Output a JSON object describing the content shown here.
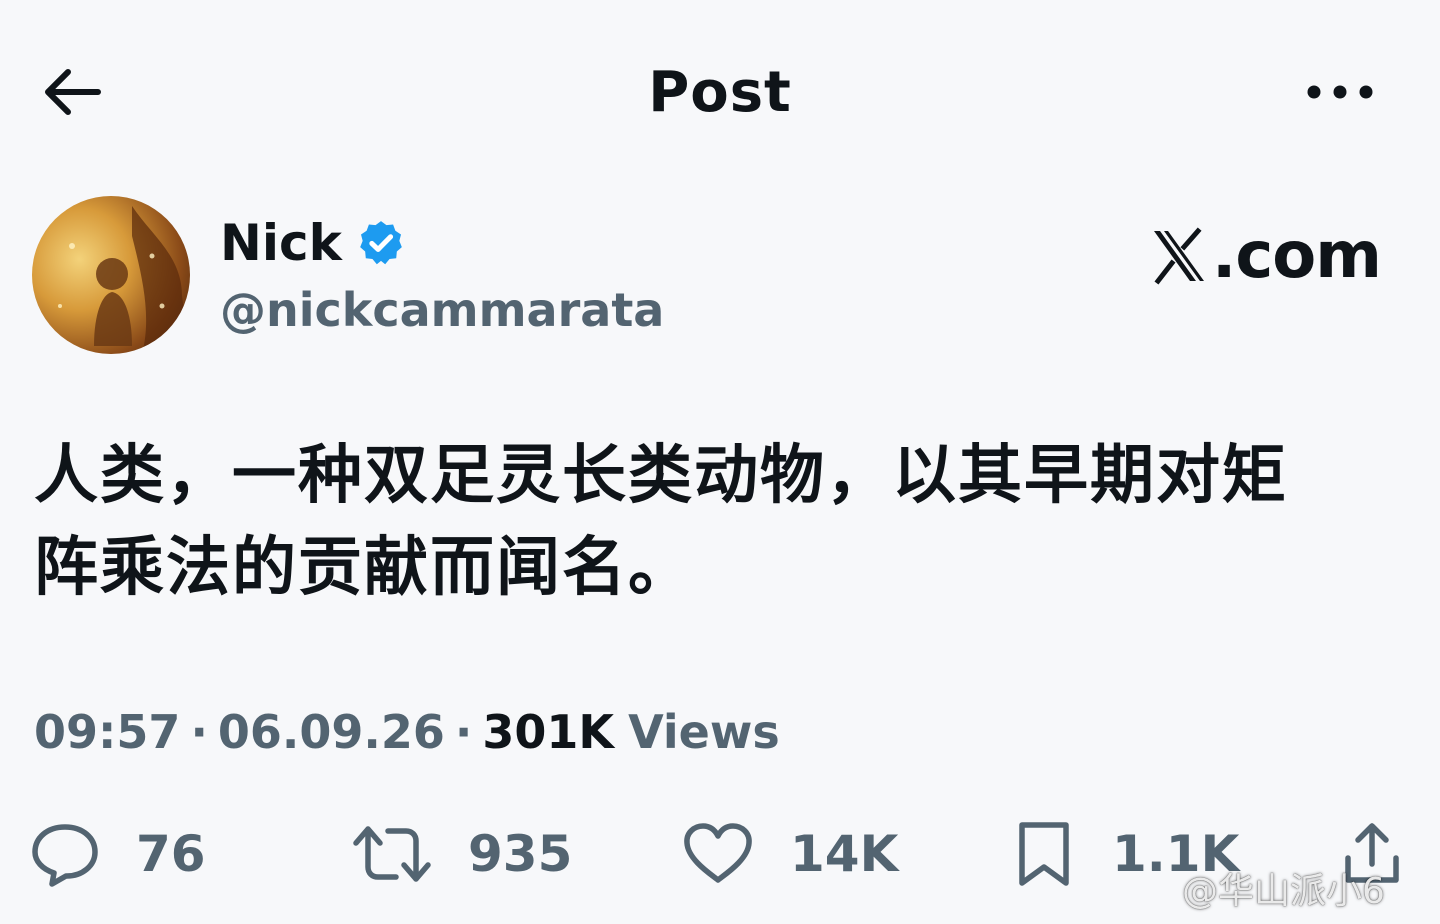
{
  "header": {
    "title": "Post"
  },
  "author": {
    "name": "Nick",
    "handle": "@nickcammarata",
    "verified": true
  },
  "brand": {
    "text": ".com"
  },
  "post": {
    "text": "人类，一种双足灵长类动物，以其早期对矩阵乘法的贡献而闻名。",
    "time": "09:57",
    "date": "06.09.26",
    "views_count": "301K",
    "views_label": "Views"
  },
  "actions": {
    "replies": "76",
    "reposts": "935",
    "likes": "14K",
    "bookmarks": "1.1K"
  },
  "watermark": {
    "text": "@华山派小6"
  },
  "colors": {
    "background": "#f7f8fa",
    "text": "#0f1419",
    "secondary": "#536471",
    "verified": "#1d9bf0"
  },
  "icons": [
    "back-arrow-icon",
    "more-icon",
    "verified-badge-icon",
    "x-logo-icon",
    "reply-icon",
    "repost-icon",
    "like-icon",
    "bookmark-icon",
    "share-icon"
  ]
}
